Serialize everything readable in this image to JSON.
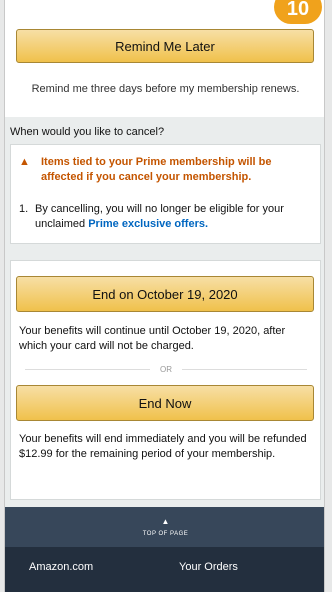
{
  "step_badge": "10",
  "remind": {
    "button_label": "Remind Me Later",
    "description": "Remind me three days before my membership renews."
  },
  "question": "When would you like to cancel?",
  "warning": {
    "icon": "warning-triangle-icon",
    "text": "Items tied to your Prime membership will be affected if you cancel your membership."
  },
  "list_item": {
    "number": "1.",
    "text": "By cancelling, you will no longer be eligible for your unclaimed",
    "link": "Prime exclusive offers."
  },
  "options": {
    "end_on_label": "End on October 19, 2020",
    "end_on_description": "Your benefits will continue until October 19, 2020, after which your card will not be charged.",
    "separator": "OR",
    "end_now_label": "End Now",
    "end_now_description": "Your benefits will end immediately and you will be refunded $12.99 for the remaining period of your membership."
  },
  "footer": {
    "top_of_page": "TOP OF PAGE",
    "nav_left": "Amazon.com",
    "nav_right": "Your Orders"
  },
  "colors": {
    "button": "#f0c14b",
    "warning": "#c45500",
    "link": "#0066c0",
    "footer_top": "#37475a",
    "footer_nav": "#232f3e",
    "badge": "#f0a21c"
  }
}
